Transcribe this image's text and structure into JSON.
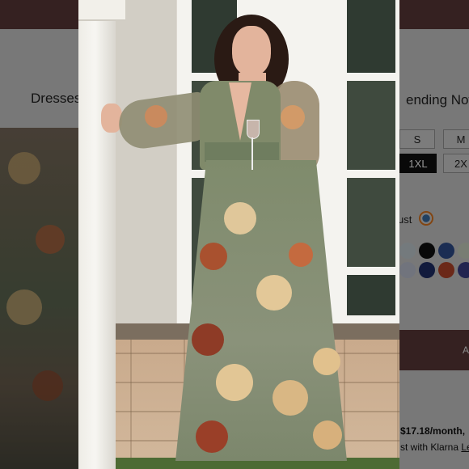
{
  "background_page": {
    "left_heading": "Dresses",
    "right_heading": "ending Now",
    "sizes": [
      {
        "label": "S",
        "selected": false
      },
      {
        "label": "M",
        "selected": false
      },
      {
        "label": "1XL",
        "selected": true
      },
      {
        "label": "2X",
        "selected": false
      }
    ],
    "color_label": "ust",
    "swatch_colors": [
      "#c9d2d8",
      "#111111",
      "#2f4f8f",
      "#cfd8c6",
      "#c3c8d8",
      "#1f2f6a",
      "#b8452a",
      "#3b3f8a"
    ],
    "price_text": "$17.18/month,",
    "klarna_text": "st with Klarna",
    "klarna_link": "Le",
    "bar_letter": "A"
  },
  "modal_image": {
    "subject": "woman in floral tulle maxi dress holding a wine glass"
  }
}
